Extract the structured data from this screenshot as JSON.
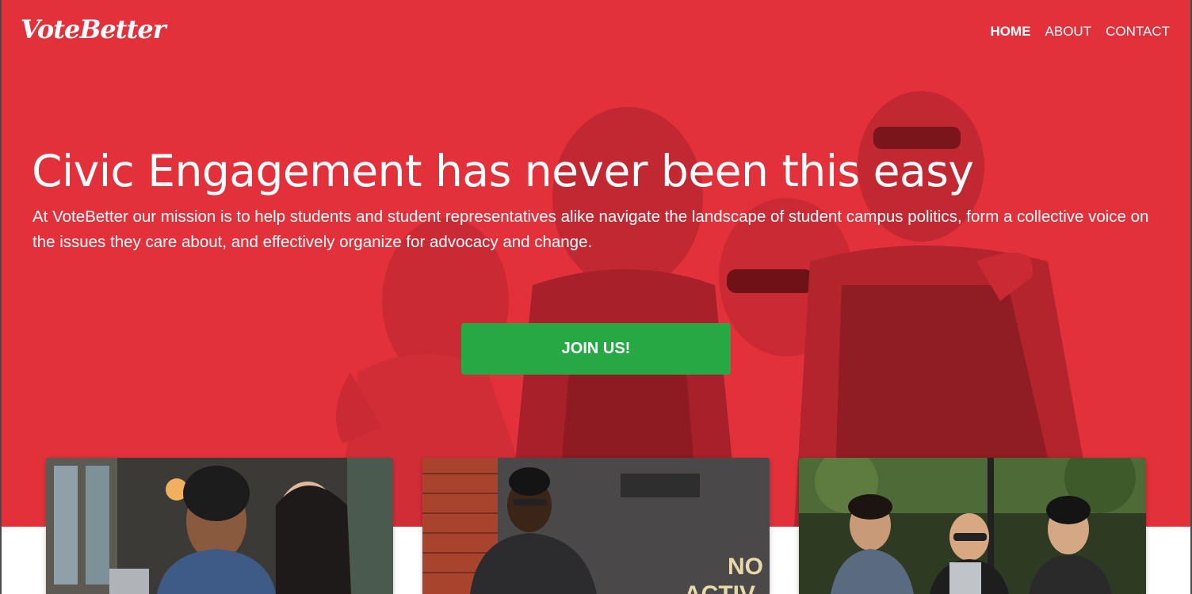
{
  "brand": {
    "name": "VoteBetter"
  },
  "nav": {
    "items": [
      {
        "label": "HOME",
        "active": true
      },
      {
        "label": "ABOUT",
        "active": false
      },
      {
        "label": "CONTACT",
        "active": false
      }
    ]
  },
  "hero": {
    "headline": "Civic Engagement has never been this easy",
    "mission": "At VoteBetter our mission is to help students and student representatives alike navigate the landscape of student campus politics, form a collective voice on the issues they care about, and effectively organize for advocacy and change.",
    "cta_label": "JOIN US!",
    "overlay_color": "#e2313b",
    "cta_color": "#28a745"
  },
  "cards": [
    {
      "sign_text": ""
    },
    {
      "sign_text_line1": "NO",
      "sign_text_line2": "ACTIV"
    },
    {
      "sign_text": ""
    }
  ]
}
